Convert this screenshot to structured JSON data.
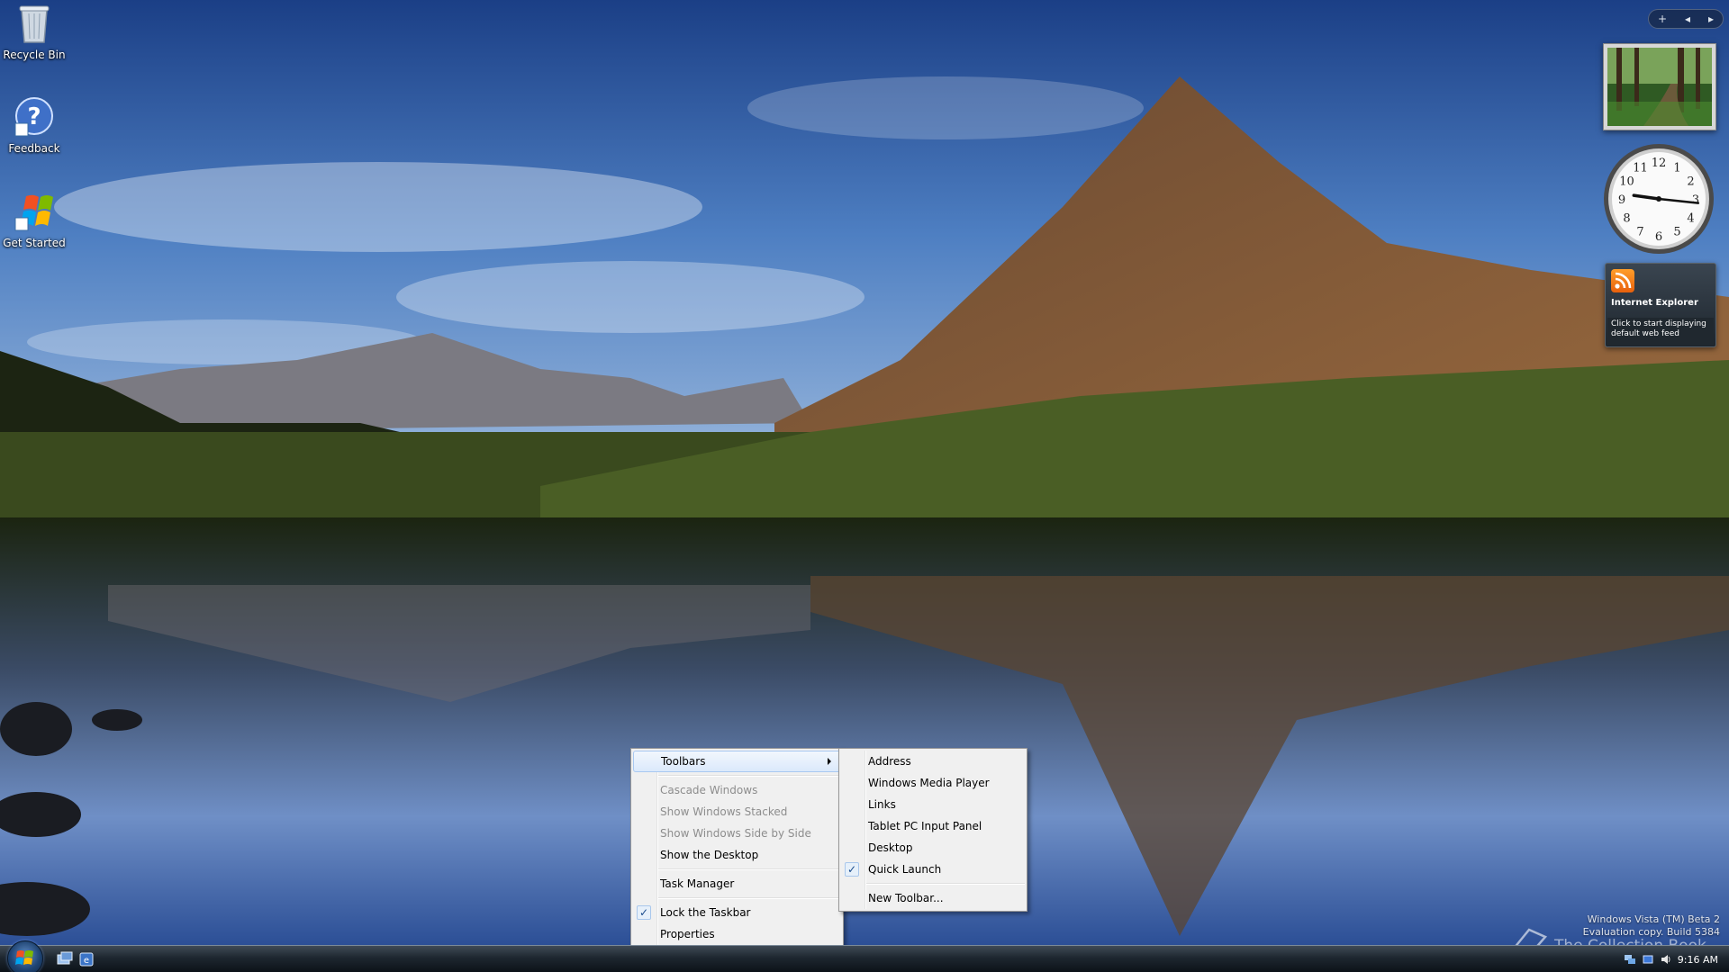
{
  "desktop": {
    "icons": [
      {
        "label": "Recycle Bin",
        "icon": "recycle-bin-icon"
      },
      {
        "label": "Feedback",
        "icon": "feedback-icon"
      },
      {
        "label": "Get Started",
        "icon": "get-started-icon"
      }
    ]
  },
  "sidebar": {
    "controls": {
      "add": "+",
      "prev": "◂",
      "next": "▸"
    },
    "clock": {
      "numbers": [
        "12",
        "1",
        "2",
        "3",
        "4",
        "5",
        "6",
        "7",
        "8",
        "9",
        "10",
        "11"
      ],
      "hour": 9,
      "minute": 16
    },
    "feed": {
      "title": "Internet Explorer",
      "message": "Click to start displaying default web feed"
    }
  },
  "context_menu": {
    "toolbars": "Toolbars",
    "cascade_windows": "Cascade Windows",
    "show_windows_stacked": "Show Windows Stacked",
    "show_windows_side_by_side": "Show Windows Side by Side",
    "show_the_desktop": "Show the Desktop",
    "task_manager": "Task Manager",
    "lock_the_taskbar": "Lock the Taskbar",
    "properties": "Properties",
    "checkmark": "✓"
  },
  "toolbars_submenu": {
    "address": "Address",
    "windows_media_player": "Windows Media Player",
    "links": "Links",
    "tablet_pc_input_panel": "Tablet PC Input Panel",
    "desktop": "Desktop",
    "quick_launch": "Quick Launch",
    "new_toolbar": "New Toolbar...",
    "checkmark": "✓"
  },
  "watermark": {
    "line1": "Windows Vista (TM) Beta 2",
    "line2": "Evaluation copy. Build 5384",
    "book": "The Collection Book"
  },
  "taskbar": {
    "clock": "9:16 AM"
  },
  "colors": {
    "taskbar": "#1e2730",
    "menu_background": "#f0f0f0",
    "menu_highlight": "#dbe9fb",
    "disabled_text": "#8d8d8d"
  }
}
